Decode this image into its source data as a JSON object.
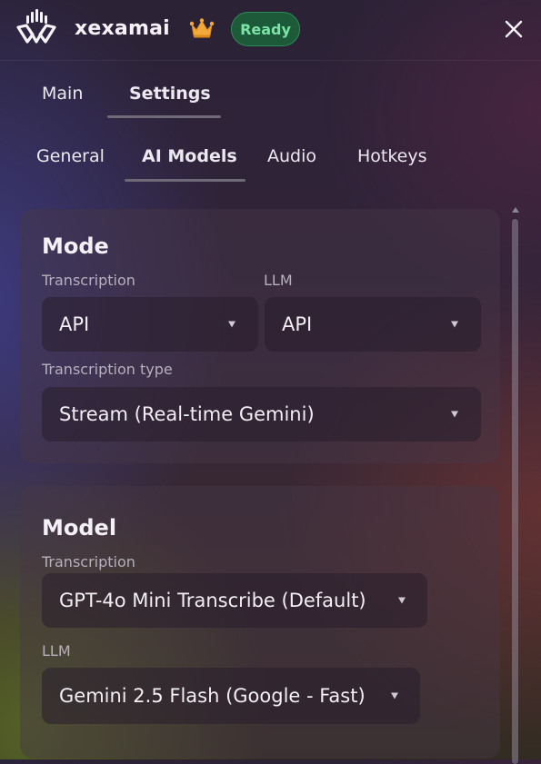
{
  "app": {
    "name": "xexamai",
    "status": "Ready",
    "logo_icon": "logo-icon",
    "premium_icon": "crown-icon",
    "close_icon": "close-icon"
  },
  "main_tabs": [
    {
      "label": "Main"
    },
    {
      "label": "Settings",
      "active": true
    }
  ],
  "sub_tabs": [
    {
      "label": "General"
    },
    {
      "label": "AI Models",
      "active": true
    },
    {
      "label": "Audio"
    },
    {
      "label": "Hotkeys"
    }
  ],
  "mode": {
    "title": "Mode",
    "transcription_label": "Transcription",
    "transcription_value": "API",
    "llm_label": "LLM",
    "llm_value": "API",
    "type_label": "Transcription type",
    "type_value": "Stream (Real-time Gemini)"
  },
  "model": {
    "title": "Model",
    "transcription_label": "Transcription",
    "transcription_value": "GPT-4o Mini Transcribe (Default)",
    "llm_label": "LLM",
    "llm_value": "Gemini 2.5 Flash (Google - Fast)"
  },
  "colors": {
    "status_bg": "#1d5a39",
    "status_text": "#7be3a5",
    "crown": "#f2a93b"
  }
}
